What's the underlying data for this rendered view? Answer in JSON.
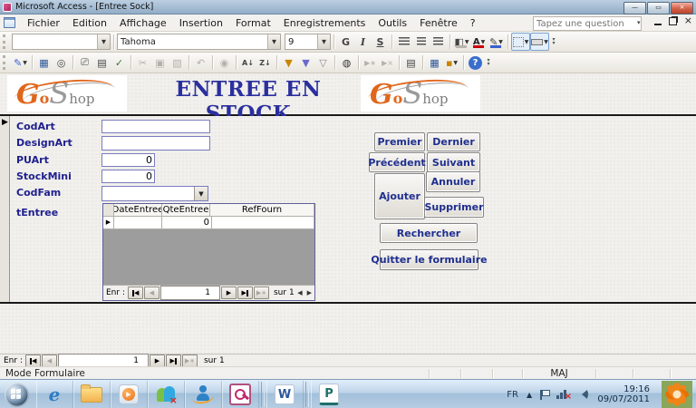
{
  "colors": {
    "title_text_blue": "#2b2f9e",
    "label_navy": "#1f1f8f",
    "brand_orange": "#e0661c",
    "button_text_navy": "#1f2f8f",
    "taskbar_blue": "#bdd3e8",
    "access_pink": "#c2286e"
  },
  "titlebar": {
    "title": "Microsoft Access - [Entree Sock]"
  },
  "menubar": {
    "items": [
      "Fichier",
      "Edition",
      "Affichage",
      "Insertion",
      "Format",
      "Enregistrements",
      "Outils",
      "Fenêtre",
      "?"
    ],
    "question_placeholder": "Tapez une question"
  },
  "format_toolbar": {
    "object_value": "",
    "font_name": "Tahoma",
    "font_size": "9",
    "bold_label": "G",
    "italic_label": "I",
    "underline_label": "S"
  },
  "standard_toolbar": {
    "icons": [
      "form-view",
      "save",
      "file-search",
      "print",
      "print-preview",
      "spelling",
      "cut",
      "copy",
      "paste",
      "undo",
      "insert-hyperlink",
      "sort-ascending",
      "sort-descending",
      "filter-by-selection",
      "filter-by-form",
      "apply-filter",
      "find",
      "new-record",
      "delete-record",
      "properties",
      "database-window",
      "new-object",
      "help"
    ],
    "sort_asc_glyph": "A↓",
    "sort_desc_glyph": "Z↓",
    "help_glyph": "?"
  },
  "form": {
    "logo": {
      "g": "G",
      "o": "o",
      "s": "S",
      "hop": "hop"
    },
    "title": "ENTREE EN STOCK",
    "fields": [
      {
        "label": "CodArt",
        "value": ""
      },
      {
        "label": "DesignArt",
        "value": ""
      },
      {
        "label": "PUArt",
        "value": "0"
      },
      {
        "label": "StockMini",
        "value": "0"
      },
      {
        "label": "CodFam",
        "value": ""
      }
    ],
    "subform": {
      "label": "tEntree",
      "columns": [
        "DateEntree",
        "QteEntree",
        "RefFourn"
      ],
      "row": {
        "date": "",
        "qte": "0",
        "ref": ""
      },
      "nav": {
        "label": "Enr :",
        "current": "1",
        "count_label": "sur 1"
      }
    },
    "buttons": {
      "premier": "Premier",
      "dernier": "Dernier",
      "precedent": "Précédent",
      "suivant": "Suivant",
      "ajouter": "Ajouter",
      "annuler": "Annuler",
      "supprimer": "Supprimer",
      "rechercher": "Rechercher",
      "quitter": "Quitter le formulaire"
    }
  },
  "main_nav": {
    "label": "Enr :",
    "current": "1",
    "count_label": "sur 1"
  },
  "statusbar": {
    "mode": "Mode Formulaire",
    "maj": "MAJ"
  },
  "taskbar": {
    "language": "FR",
    "time": "19:16",
    "date": "09/07/2011",
    "icons": [
      "start-orb",
      "internet-explorer",
      "windows-explorer",
      "media-player",
      "messenger",
      "msn",
      "access",
      "word",
      "powerpoint"
    ],
    "tray_icons": [
      "hidden-icons",
      "action-center",
      "network",
      "volume"
    ]
  }
}
